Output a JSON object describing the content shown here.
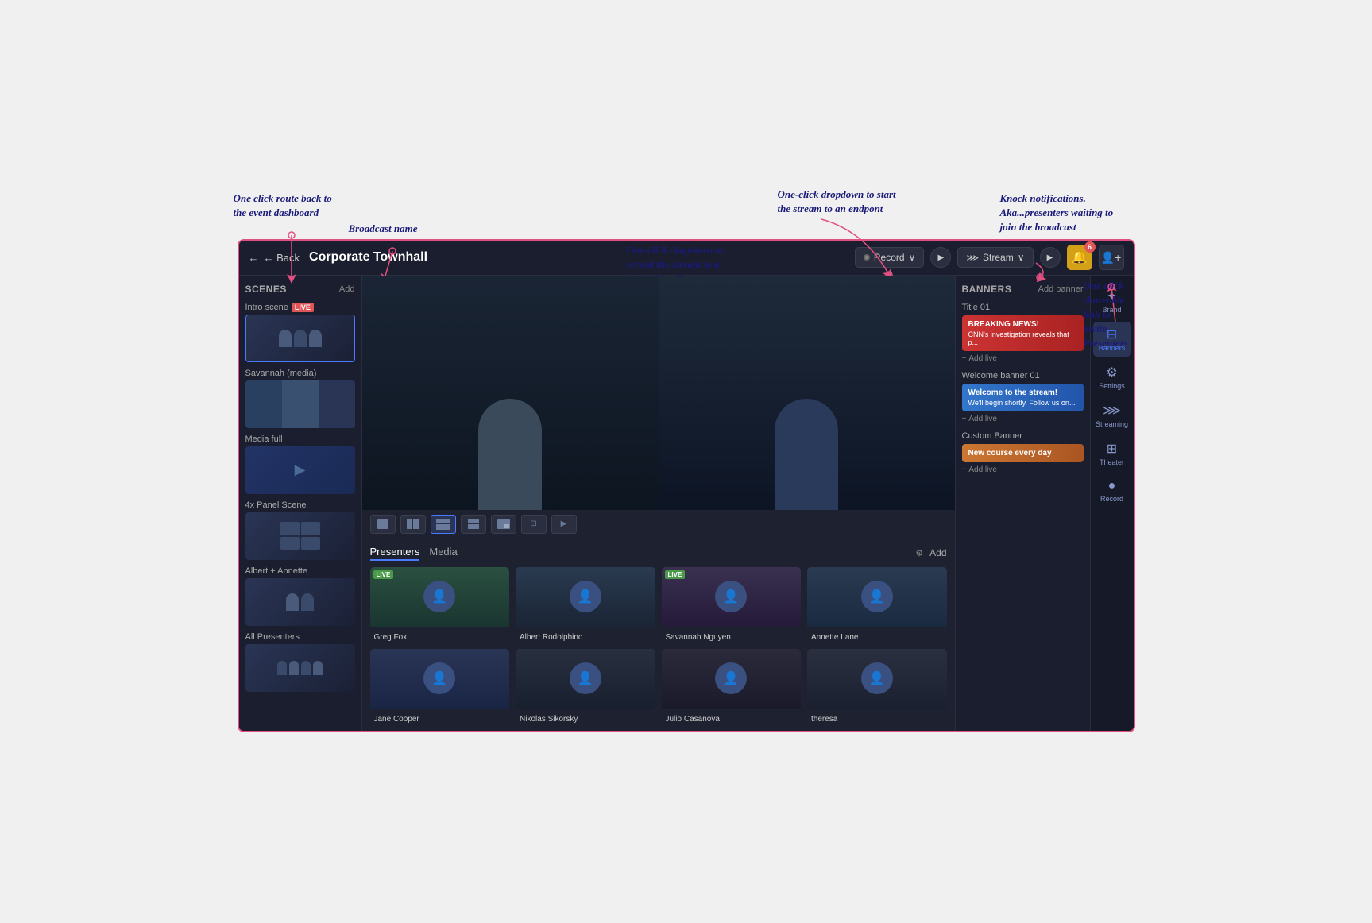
{
  "broadcast": {
    "title": "Corporate Townhall",
    "back_label": "← Back"
  },
  "header": {
    "record_label": "Record",
    "stream_label": "Stream",
    "notification_count": "6",
    "play_icon": "▶",
    "chevron": "∨"
  },
  "annotations": {
    "back_callout": "One click route back to\nthe event dashboard",
    "broadcast_name_callout": "Broadcast name",
    "record_callout": "One-click dropdown to\nrecord the stream to a\nlocal video file",
    "stream_callout": "One-click dropdown to start\nthe stream to an endpont",
    "knock_callout": "Knock notifications.\nAka...presenters waiting to\njoin the broadcast",
    "invite_callout": "One click\nshareable link to\ninvite Presenters"
  },
  "scenes": {
    "title": "Scenes",
    "add_label": "Add",
    "items": [
      {
        "name": "Intro scene",
        "live": true
      },
      {
        "name": "Savannah (media)",
        "live": false
      },
      {
        "name": "Media full",
        "live": false
      },
      {
        "name": "4x Panel Scene",
        "live": false
      },
      {
        "name": "Albert + Annette",
        "live": false
      },
      {
        "name": "All Presenters",
        "live": false
      }
    ]
  },
  "presenters": {
    "tab_presenters": "Presenters",
    "tab_media": "Media",
    "add_label": "Add",
    "items": [
      {
        "name": "Greg Fox",
        "live": true
      },
      {
        "name": "Albert Rodolphino",
        "live": false
      },
      {
        "name": "Savannah Nguyen",
        "live": true
      },
      {
        "name": "Annette Lane",
        "live": false
      },
      {
        "name": "Jane Cooper",
        "live": false
      },
      {
        "name": "Nikolas Sikorsky",
        "live": false
      },
      {
        "name": "Julio Casanova",
        "live": false
      },
      {
        "name": "theresa",
        "live": false
      }
    ]
  },
  "banners": {
    "title": "Banners",
    "add_banner_label": "Add banner",
    "sections": [
      {
        "title": "Title 01",
        "name": "BREAKING NEWS!",
        "sub": "CNN's investigation reveals that p...",
        "type": "breaking",
        "add_label": "Add live"
      },
      {
        "title": "Welcome banner 01",
        "name": "Welcome to the stream!",
        "sub": "We'll begin shortly. Follow us on...",
        "type": "welcome",
        "add_label": "Add live"
      },
      {
        "title": "Custom Banner",
        "name": "New course every day",
        "sub": "",
        "type": "custom",
        "add_label": "Add live"
      }
    ]
  },
  "rail": {
    "items": [
      {
        "label": "Brand",
        "icon": "✦",
        "active": false
      },
      {
        "label": "Banners",
        "icon": "⊟",
        "active": true
      },
      {
        "label": "Settings",
        "icon": "⚙",
        "active": false
      },
      {
        "label": "Streaming",
        "icon": "⋙",
        "active": false
      },
      {
        "label": "Theater",
        "icon": "⊞",
        "active": false
      },
      {
        "label": "Record",
        "icon": "●",
        "active": false
      }
    ]
  }
}
